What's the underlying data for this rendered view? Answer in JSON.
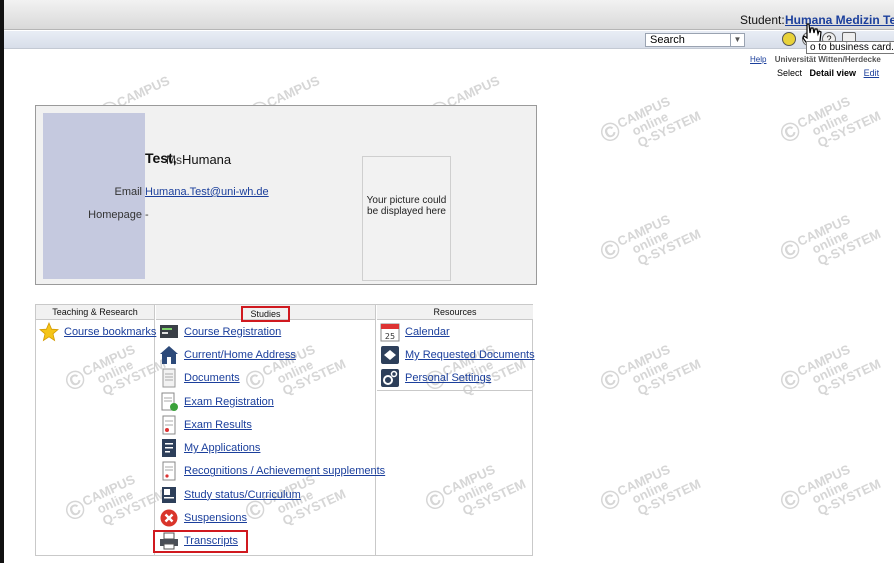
{
  "topbar": {
    "student_label": "Student:",
    "student_name": "Humana Medizin Tes",
    "tooltip": "o to business card..."
  },
  "navbar": {
    "search_select": "Search",
    "help_link": "Help",
    "university": "Universität Witten/Herdecke",
    "select_label": "Select",
    "detail_view": "Detail view",
    "edit": "Edit"
  },
  "profile": {
    "salutation": "Ms",
    "last_name": "Test,",
    "first_name": "Humana",
    "email_label": "Email",
    "email": "Humana.Test@uni-wh.de",
    "homepage_label": "Homepage",
    "homepage": "-",
    "picture_placeholder": "Your picture could be displayed here"
  },
  "columns": {
    "teaching": {
      "title": "Teaching & Research",
      "items": [
        {
          "label": "Course bookmarks",
          "icon": "star-icon"
        }
      ]
    },
    "studies": {
      "title": "Studies",
      "items": [
        {
          "label": "Course Registration",
          "icon": "course-registration-icon"
        },
        {
          "label": "Current/Home Address",
          "icon": "house-icon"
        },
        {
          "label": "Documents",
          "icon": "document-icon"
        },
        {
          "label": "Exam Registration",
          "icon": "exam-registration-icon"
        },
        {
          "label": "Exam Results",
          "icon": "exam-results-icon"
        },
        {
          "label": "My Applications",
          "icon": "applications-icon"
        },
        {
          "label": "Recognitions / Achievement supplements",
          "icon": "recognitions-icon"
        },
        {
          "label": "Study status/Curriculum",
          "icon": "study-status-icon"
        },
        {
          "label": "Suspensions",
          "icon": "suspension-icon"
        },
        {
          "label": "Transcripts",
          "icon": "printer-icon"
        }
      ]
    },
    "resources": {
      "title": "Resources",
      "items": [
        {
          "label": "Calendar",
          "icon": "calendar-icon"
        },
        {
          "label": "My Requested Documents",
          "icon": "requested-documents-icon"
        },
        {
          "label": "Personal Settings",
          "icon": "gears-icon"
        }
      ]
    }
  },
  "watermark": {
    "line1": "CAMPUS",
    "line2": "online",
    "line3": "Q-SYSTEM"
  },
  "calendar_day": "25"
}
